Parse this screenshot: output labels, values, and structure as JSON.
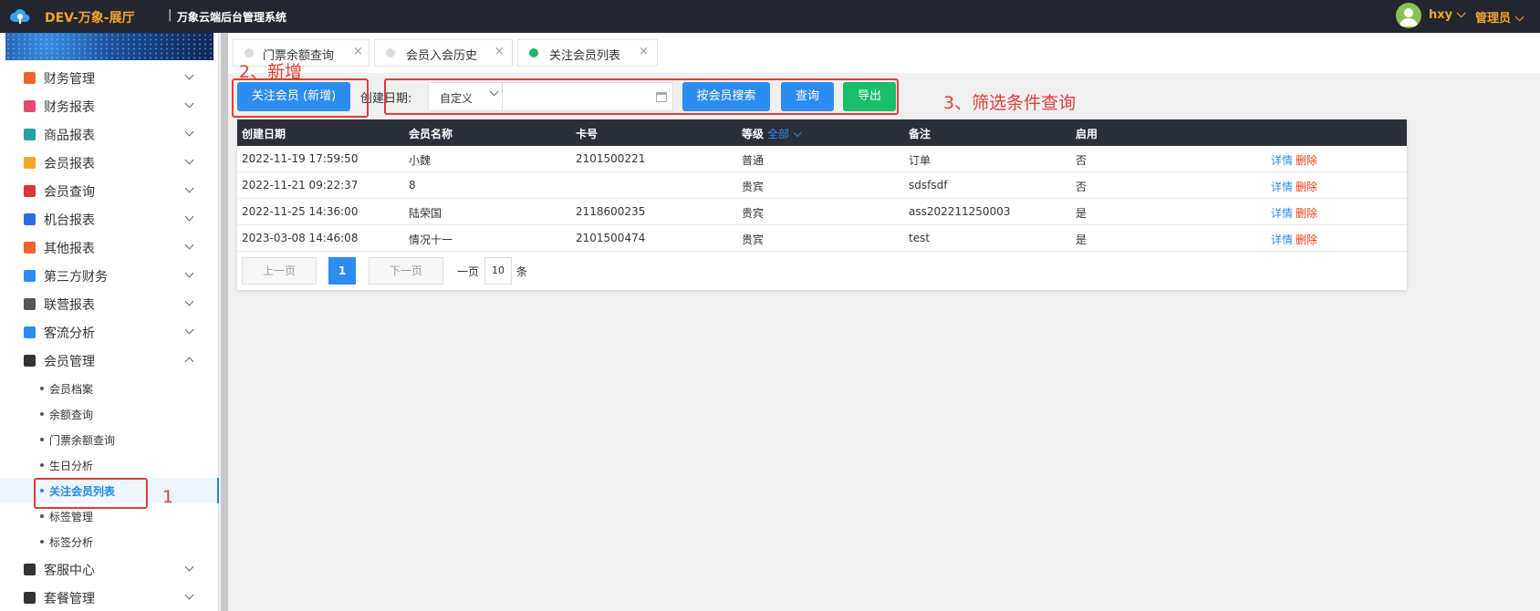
{
  "header": {
    "brand": "DEV-万象-展厅",
    "separator": "|",
    "system": "万象云端后台管理系统",
    "user": "hxy",
    "role": "管理员",
    "accent": "#f4a62a"
  },
  "sidebar": {
    "menu": [
      {
        "label": "财务管理",
        "icon": "finance-icon",
        "color": "#f0642d"
      },
      {
        "label": "财务报表",
        "icon": "report-icon",
        "color": "#e84a6f"
      },
      {
        "label": "商品报表",
        "icon": "goods-icon",
        "color": "#21a3a3"
      },
      {
        "label": "会员报表",
        "icon": "member-report-icon",
        "color": "#f4a62a"
      },
      {
        "label": "会员查询",
        "icon": "member-query-icon",
        "color": "#d9363e"
      },
      {
        "label": "机台报表",
        "icon": "machine-icon",
        "color": "#2d6cdf"
      },
      {
        "label": "其他报表",
        "icon": "layers-icon",
        "color": "#f0642d"
      },
      {
        "label": "第三方财务",
        "icon": "calculator-icon",
        "color": "#2d8cf0"
      },
      {
        "label": "联营报表",
        "icon": "users-icon",
        "color": "#555555"
      },
      {
        "label": "客流分析",
        "icon": "target-icon",
        "color": "#2d8cf0"
      },
      {
        "label": "会员管理",
        "icon": "user-circle-icon",
        "color": "#333333"
      }
    ],
    "submenu": [
      {
        "label": "会员档案"
      },
      {
        "label": "余额查询"
      },
      {
        "label": "门票余额查询"
      },
      {
        "label": "生日分析"
      },
      {
        "label": "关注会员列表"
      },
      {
        "label": "标签管理"
      },
      {
        "label": "标签分析"
      }
    ],
    "menu_after": [
      {
        "label": "客服中心",
        "icon": "headset-icon",
        "color": "#333333"
      },
      {
        "label": "套餐管理",
        "icon": "edit-icon",
        "color": "#333333"
      }
    ]
  },
  "tabs": [
    {
      "label": "门票余额查询",
      "close": "×"
    },
    {
      "label": "会员入会历史",
      "close": "×"
    },
    {
      "label": "关注会员列表",
      "close": "×"
    }
  ],
  "toolbar": {
    "add_button": "关注会员 (新增)",
    "date_label": "创建日期:",
    "date_mode": "自定义",
    "date_value": "",
    "search_member": "按会员搜索",
    "query": "查询",
    "export": "导出"
  },
  "annotations": {
    "one": "1",
    "two": "2、新增",
    "three": "3、筛选条件查询"
  },
  "table": {
    "columns": {
      "created": "创建日期",
      "name": "会员名称",
      "card": "卡号",
      "level": "等级",
      "level_filter": "全部",
      "note": "备注",
      "enabled": "启用"
    },
    "rows": [
      {
        "created": "2022-11-19 17:59:50",
        "name": "小魏",
        "card": "2101500221",
        "level": "普通",
        "note": "订单",
        "enabled": "否"
      },
      {
        "created": "2022-11-21 09:22:37",
        "name": "8",
        "card": "",
        "level": "贵宾",
        "note": "sdsfsdf",
        "enabled": "否"
      },
      {
        "created": "2022-11-25 14:36:00",
        "name": "陆荣国",
        "card": "2118600235",
        "level": "贵宾",
        "note": "ass202211250003",
        "enabled": "是"
      },
      {
        "created": "2023-03-08 14:46:08",
        "name": "情况十一",
        "card": "2101500474",
        "level": "贵宾",
        "note": "test",
        "enabled": "是"
      }
    ],
    "action_detail": "详情",
    "action_delete": "删除"
  },
  "pager": {
    "prev": "上一页",
    "current": "1",
    "next": "下一页",
    "per_page_label": "一页",
    "per_page": "10",
    "unit": "条"
  }
}
